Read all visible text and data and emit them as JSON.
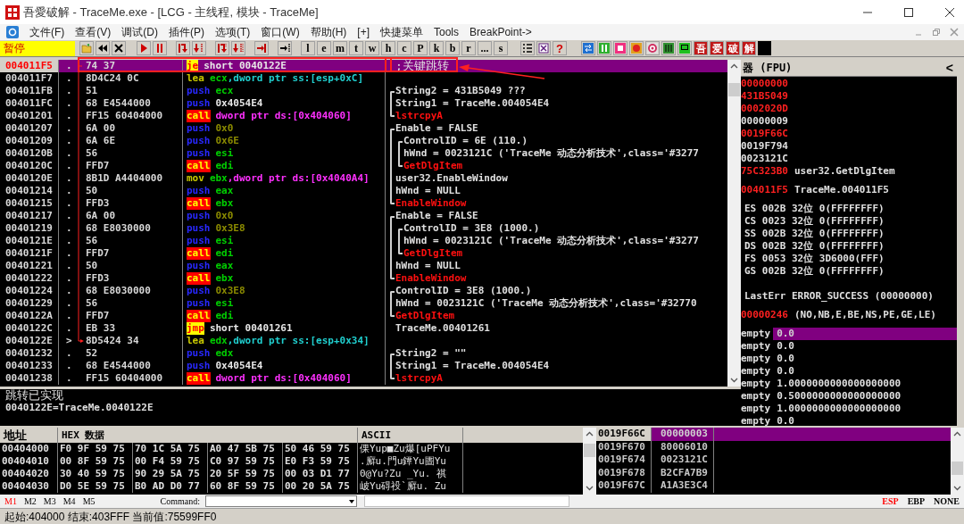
{
  "window": {
    "title": "吾愛破解 - TraceMe.exe - [LCG - 主线程, 模块 - TraceMe]"
  },
  "menu": [
    "文件(F)",
    "查看(V)",
    "调试(D)",
    "插件(P)",
    "选项(T)",
    "窗口(W)",
    "帮助(H)",
    "[+]",
    "快捷菜单",
    "Tools",
    "BreakPoint->"
  ],
  "toolbar": {
    "status": "暂停",
    "letter_buttons": [
      "l",
      "e",
      "m",
      "t",
      "w",
      "h",
      "c",
      "P",
      "k",
      "b",
      "r",
      "...",
      "s"
    ],
    "help_button": "?",
    "brand_buttons": [
      "吾",
      "爱",
      "破",
      "解"
    ]
  },
  "disassembly": [
    {
      "address": "004011F5",
      "marker": ".",
      "hex": "74 37",
      "mnemonic": {
        "text": "je",
        "kind": "jump"
      },
      "operands": [
        {
          "text": "short 0040122E",
          "kind": "address"
        }
      ],
      "comment": {
        "text": ";关键跳转",
        "kind": "note"
      },
      "selected": true,
      "annotated": true,
      "jump_start": true
    },
    {
      "address": "004011F7",
      "marker": ".",
      "hex": "8D4C24 0C",
      "mnemonic": {
        "text": "lea",
        "kind": "move"
      },
      "operands": [
        {
          "text": "ecx",
          "kind": "register"
        },
        {
          "text": ",dword ptr ss:[esp+0xC]",
          "kind": "memory_ss"
        }
      ],
      "selected": false
    },
    {
      "address": "004011FB",
      "marker": ".",
      "hex": "51",
      "mnemonic": {
        "text": "push",
        "kind": "push"
      },
      "operands": [
        {
          "text": "ecx",
          "kind": "register"
        }
      ],
      "comment": {
        "text": "String2 = 431B5049 ???",
        "kind": "arg",
        "bracket": {
          "kind": "top"
        }
      },
      "selected": false
    },
    {
      "address": "004011FC",
      "marker": ".",
      "hex": "68 E4544000",
      "mnemonic": {
        "text": "push",
        "kind": "push"
      },
      "operands": [
        {
          "text": "0x4054E4",
          "kind": "address"
        }
      ],
      "comment": {
        "text": "String1 = TraceMe.004054E4",
        "kind": "arg",
        "bracket": {
          "kind": "middle"
        }
      },
      "selected": false
    },
    {
      "address": "00401201",
      "marker": ".",
      "hex": "FF15 60404000",
      "mnemonic": {
        "text": "call",
        "kind": "call"
      },
      "operands": [
        {
          "text": "dword ptr ds:[0x404060]",
          "kind": "memory_ds"
        }
      ],
      "comment": {
        "text": "lstrcpyA",
        "kind": "api",
        "bracket": {
          "kind": "bottom"
        }
      },
      "selected": false
    },
    {
      "address": "00401207",
      "marker": ".",
      "hex": "6A 00",
      "mnemonic": {
        "text": "push",
        "kind": "push"
      },
      "operands": [
        {
          "text": "0x0",
          "kind": "immediate"
        }
      ],
      "comment": {
        "text": "Enable = FALSE",
        "kind": "arg",
        "bracket": {
          "kind": "top"
        }
      },
      "selected": false
    },
    {
      "address": "00401209",
      "marker": ".",
      "hex": "6A 6E",
      "mnemonic": {
        "text": "push",
        "kind": "push"
      },
      "operands": [
        {
          "text": "0x6E",
          "kind": "immediate"
        }
      ],
      "comment": {
        "text": "ControlID = 6E (110.)",
        "kind": "arg",
        "bracket": {
          "kind": "middle"
        },
        "inner_bracket": {
          "kind": "top"
        }
      },
      "selected": false
    },
    {
      "address": "0040120B",
      "marker": ".",
      "hex": "56",
      "mnemonic": {
        "text": "push",
        "kind": "push"
      },
      "operands": [
        {
          "text": "esi",
          "kind": "register"
        }
      ],
      "comment": {
        "text": "hWnd = 0023121C ('TraceMe 动态分析技术',class='#3277",
        "kind": "arg",
        "bracket": {
          "kind": "middle"
        },
        "inner_bracket": {
          "kind": "middle"
        }
      },
      "selected": false
    },
    {
      "address": "0040120C",
      "marker": ".",
      "hex": "FFD7",
      "mnemonic": {
        "text": "call",
        "kind": "call"
      },
      "operands": [
        {
          "text": "edi",
          "kind": "register"
        }
      ],
      "comment": {
        "text": "GetDlgItem",
        "kind": "api",
        "bracket": {
          "kind": "middle"
        },
        "inner_bracket": {
          "kind": "bottom"
        }
      },
      "selected": false
    },
    {
      "address": "0040120E",
      "marker": ".",
      "hex": "8B1D A4404000",
      "mnemonic": {
        "text": "mov",
        "kind": "move"
      },
      "operands": [
        {
          "text": "ebx",
          "kind": "register"
        },
        {
          "text": ",dword ptr ds:[0x4040A4]",
          "kind": "memory_ds"
        }
      ],
      "comment": {
        "text": "user32.EnableWindow",
        "kind": "arg",
        "bracket": {
          "kind": "middle"
        }
      },
      "selected": false
    },
    {
      "address": "00401214",
      "marker": ".",
      "hex": "50",
      "mnemonic": {
        "text": "push",
        "kind": "push"
      },
      "operands": [
        {
          "text": "eax",
          "kind": "register"
        }
      ],
      "comment": {
        "text": "hWnd = NULL",
        "kind": "arg",
        "bracket": {
          "kind": "middle"
        }
      },
      "selected": false
    },
    {
      "address": "00401215",
      "marker": ".",
      "hex": "FFD3",
      "mnemonic": {
        "text": "call",
        "kind": "call"
      },
      "operands": [
        {
          "text": "ebx",
          "kind": "register"
        }
      ],
      "comment": {
        "text": "EnableWindow",
        "kind": "api",
        "bracket": {
          "kind": "bottom"
        }
      },
      "selected": false
    },
    {
      "address": "00401217",
      "marker": ".",
      "hex": "6A 00",
      "mnemonic": {
        "text": "push",
        "kind": "push"
      },
      "operands": [
        {
          "text": "0x0",
          "kind": "immediate"
        }
      ],
      "comment": {
        "text": "Enable = FALSE",
        "kind": "arg",
        "bracket": {
          "kind": "top"
        }
      },
      "selected": false
    },
    {
      "address": "00401219",
      "marker": ".",
      "hex": "68 E8030000",
      "mnemonic": {
        "text": "push",
        "kind": "push"
      },
      "operands": [
        {
          "text": "0x3E8",
          "kind": "immediate"
        }
      ],
      "comment": {
        "text": "ControlID = 3E8 (1000.)",
        "kind": "arg",
        "bracket": {
          "kind": "middle"
        },
        "inner_bracket": {
          "kind": "top"
        }
      },
      "selected": false
    },
    {
      "address": "0040121E",
      "marker": ".",
      "hex": "56",
      "mnemonic": {
        "text": "push",
        "kind": "push"
      },
      "operands": [
        {
          "text": "esi",
          "kind": "register"
        }
      ],
      "comment": {
        "text": "hWnd = 0023121C ('TraceMe 动态分析技术',class='#3277",
        "kind": "arg",
        "bracket": {
          "kind": "middle"
        },
        "inner_bracket": {
          "kind": "middle"
        }
      },
      "selected": false
    },
    {
      "address": "0040121F",
      "marker": ".",
      "hex": "FFD7",
      "mnemonic": {
        "text": "call",
        "kind": "call"
      },
      "operands": [
        {
          "text": "edi",
          "kind": "register"
        }
      ],
      "comment": {
        "text": "GetDlgItem",
        "kind": "api",
        "bracket": {
          "kind": "middle"
        },
        "inner_bracket": {
          "kind": "bottom"
        }
      },
      "selected": false
    },
    {
      "address": "00401221",
      "marker": ".",
      "hex": "50",
      "mnemonic": {
        "text": "push",
        "kind": "push"
      },
      "operands": [
        {
          "text": "eax",
          "kind": "register"
        }
      ],
      "comment": {
        "text": "hWnd = NULL",
        "kind": "arg",
        "bracket": {
          "kind": "middle"
        }
      },
      "selected": false
    },
    {
      "address": "00401222",
      "marker": ".",
      "hex": "FFD3",
      "mnemonic": {
        "text": "call",
        "kind": "call"
      },
      "operands": [
        {
          "text": "ebx",
          "kind": "register"
        }
      ],
      "comment": {
        "text": "EnableWindow",
        "kind": "api",
        "bracket": {
          "kind": "bottom"
        }
      },
      "selected": false
    },
    {
      "address": "00401224",
      "marker": ".",
      "hex": "68 E8030000",
      "mnemonic": {
        "text": "push",
        "kind": "push"
      },
      "operands": [
        {
          "text": "0x3E8",
          "kind": "immediate"
        }
      ],
      "comment": {
        "text": "ControlID = 3E8 (1000.)",
        "kind": "arg",
        "bracket": {
          "kind": "top"
        }
      },
      "selected": false
    },
    {
      "address": "00401229",
      "marker": ".",
      "hex": "56",
      "mnemonic": {
        "text": "push",
        "kind": "push"
      },
      "operands": [
        {
          "text": "esi",
          "kind": "register"
        }
      ],
      "comment": {
        "text": "hWnd = 0023121C ('TraceMe 动态分析技术',class='#32770",
        "kind": "arg",
        "bracket": {
          "kind": "middle"
        }
      },
      "selected": false
    },
    {
      "address": "0040122A",
      "marker": ".",
      "hex": "FFD7",
      "mnemonic": {
        "text": "call",
        "kind": "call"
      },
      "operands": [
        {
          "text": "edi",
          "kind": "register"
        }
      ],
      "comment": {
        "text": "GetDlgItem",
        "kind": "api",
        "bracket": {
          "kind": "bottom"
        }
      },
      "selected": false
    },
    {
      "address": "0040122C",
      "marker": ".",
      "hex": "EB 33",
      "mnemonic": {
        "text": "jmp",
        "kind": "jump"
      },
      "operands": [
        {
          "text": "short 00401261",
          "kind": "address"
        }
      ],
      "comment": {
        "text": "TraceMe.00401261",
        "kind": "arg"
      },
      "selected": false
    },
    {
      "address": "0040122E",
      "marker": ">",
      "hex": "8D5424 34",
      "mnemonic": {
        "text": "lea",
        "kind": "move"
      },
      "operands": [
        {
          "text": "edx",
          "kind": "register"
        },
        {
          "text": ",dword ptr ss:[esp+0x34]",
          "kind": "memory_ss"
        }
      ],
      "selected": false,
      "jump_end": true
    },
    {
      "address": "00401232",
      "marker": ".",
      "hex": "52",
      "mnemonic": {
        "text": "push",
        "kind": "push"
      },
      "operands": [
        {
          "text": "edx",
          "kind": "register"
        }
      ],
      "comment": {
        "text": "String2 = \"\"",
        "kind": "arg",
        "bracket": {
          "kind": "top"
        }
      },
      "selected": false
    },
    {
      "address": "00401233",
      "marker": ".",
      "hex": "68 E4544000",
      "mnemonic": {
        "text": "push",
        "kind": "push"
      },
      "operands": [
        {
          "text": "0x4054E4",
          "kind": "address"
        }
      ],
      "comment": {
        "text": "String1 = TraceMe.004054E4",
        "kind": "arg",
        "bracket": {
          "kind": "middle"
        }
      },
      "selected": false
    },
    {
      "address": "00401238",
      "marker": ".",
      "hex": "FF15 60404000",
      "mnemonic": {
        "text": "call",
        "kind": "call"
      },
      "operands": [
        {
          "text": "dword ptr ds:[0x404060]",
          "kind": "memory_ds"
        }
      ],
      "comment": {
        "text": "lstrcpyA",
        "kind": "api",
        "bracket": {
          "kind": "bottom"
        }
      },
      "selected": false
    }
  ],
  "info": [
    "跳转已实现",
    "0040122E=TraceMe.0040122E"
  ],
  "registers": {
    "title": "器 (FPU)",
    "collapse_button": "<",
    "general": [
      {
        "value": "00000000",
        "changed": true
      },
      {
        "value": "431B5049",
        "changed": true
      },
      {
        "value": "0002020D",
        "changed": true
      },
      {
        "value": "00000009",
        "changed": false
      },
      {
        "value": "0019F66C",
        "changed": true
      },
      {
        "value": "0019F794",
        "changed": false
      },
      {
        "value": "0023121C",
        "changed": false
      },
      {
        "value": "75C323B0",
        "changed": true,
        "comment": "user32.GetDlgItem"
      }
    ],
    "eip": {
      "value": "004011F5",
      "changed": true,
      "comment": "TraceMe.004011F5"
    },
    "segments": [
      "ES 002B 32位 0(FFFFFFFF)",
      "CS 0023 32位 0(FFFFFFFF)",
      "SS 002B 32位 0(FFFFFFFF)",
      "DS 002B 32位 0(FFFFFFFF)",
      "FS 0053 32位 3D6000(FFF)",
      "GS 002B 32位 0(FFFFFFFF)"
    ],
    "last_error": "LastErr ERROR_SUCCESS (00000000)",
    "flags": {
      "value": "00000246",
      "changed": true,
      "comment": "(NO,NB,E,BE,NS,PE,GE,LE)"
    },
    "fpu": [
      {
        "tag": "empty",
        "value": "0.0",
        "selected": true
      },
      {
        "tag": "empty",
        "value": "0.0",
        "selected": false
      },
      {
        "tag": "empty",
        "value": "0.0",
        "selected": false
      },
      {
        "tag": "empty",
        "value": "0.0",
        "selected": false
      },
      {
        "tag": "empty",
        "value": "1.0000000000000000000",
        "selected": false
      },
      {
        "tag": "empty",
        "value": "0.5000000000000000000",
        "selected": false
      },
      {
        "tag": "empty",
        "value": "1.0000000000000000000",
        "selected": false
      },
      {
        "tag": "empty",
        "value": "0.0",
        "selected": false
      }
    ]
  },
  "dump": {
    "columns": [
      "地址",
      "HEX 数据",
      "ASCII"
    ],
    "rows": [
      {
        "address": "00404000",
        "hex": [
          "F0 9F 59 75",
          "70 1C 5A 75",
          "A0 47 5B 75",
          "50 46 59 75"
        ],
        "ascii": "倮Yup■Zu爆[uPFYu"
      },
      {
        "address": "00404010",
        "hex": [
          "00 8F 59 75",
          "00 F4 59 75",
          "C0 97 59 75",
          "E0 F3 59 75"
        ],
        "ascii": ".廯u.門u鐔Yu圕Yu"
      },
      {
        "address": "00404020",
        "hex": [
          "30 40 59 75",
          "90 29 5A 75",
          "20 5F 59 75",
          "00 03 D1 77"
        ],
        "ascii": "0@Yu?Zu _Yu. 祺"
      },
      {
        "address": "00404030",
        "hex": [
          "D0 5E 59 75",
          "B0 AD D0 77",
          "60 8F 59 75",
          "00 20 5A 75"
        ],
        "ascii": "岥Yu碍祋`廯u. Zu"
      }
    ]
  },
  "stack": [
    {
      "address": "0019F66C",
      "value": "00000003",
      "selected": true
    },
    {
      "address": "0019F670",
      "value": "80006010",
      "selected": false
    },
    {
      "address": "0019F674",
      "value": "0023121C",
      "selected": false
    },
    {
      "address": "0019F678",
      "value": "B2CFA7B9",
      "selected": false
    },
    {
      "address": "0019F67C",
      "value": "A1A3E3C4",
      "selected": false
    }
  ],
  "command_bar": {
    "marks": [
      {
        "label": "M1",
        "selected": true
      },
      {
        "label": "M2",
        "selected": false
      },
      {
        "label": "M3",
        "selected": false
      },
      {
        "label": "M4",
        "selected": false
      },
      {
        "label": "M5",
        "selected": false
      }
    ],
    "command_label": "Command:",
    "stack_bases": [
      {
        "label": "ESP",
        "selected": true
      },
      {
        "label": "EBP",
        "selected": false
      },
      {
        "label": "NONE",
        "selected": false
      }
    ]
  },
  "status_bar": "起始:404000 结束:403FFF 当前值:75599FF0"
}
